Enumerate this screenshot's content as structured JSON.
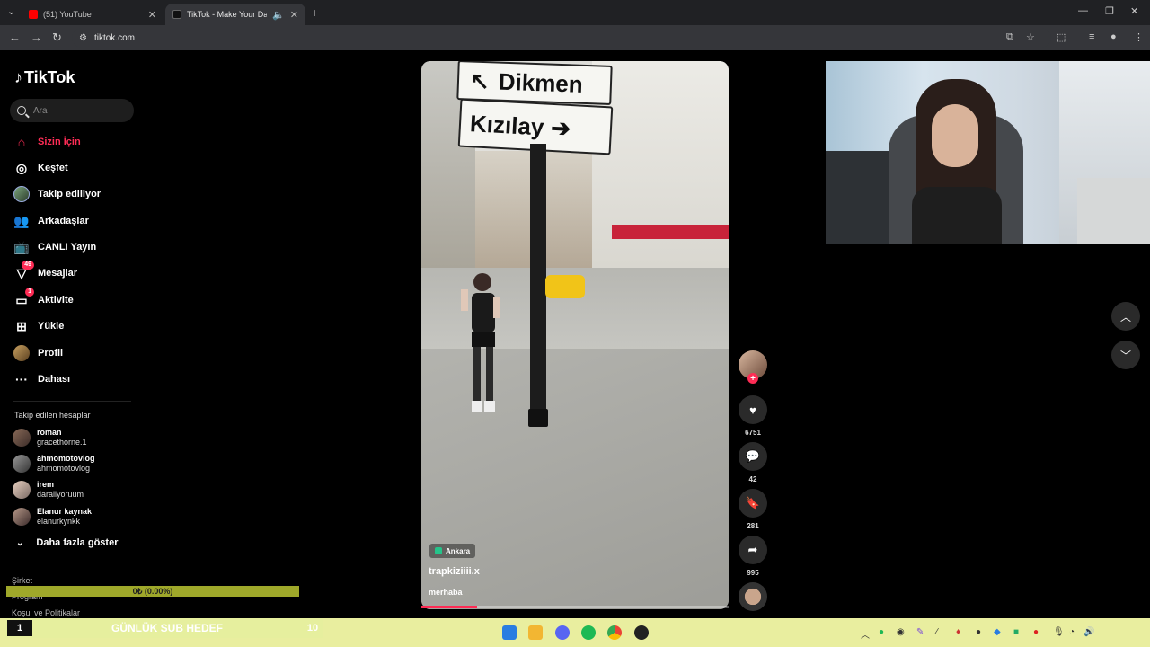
{
  "browser": {
    "tabs": [
      {
        "title": "(51) YouTube",
        "favicon": "youtube-icon",
        "active": false
      },
      {
        "title": "TikTok - Make Your Day",
        "favicon": "tiktok-icon",
        "active": true
      }
    ],
    "url": "tiktok.com"
  },
  "sidebar": {
    "logo": "TikTok",
    "search_placeholder": "Ara",
    "nav": [
      {
        "label": "Sizin İçin",
        "icon": "home-icon",
        "active": true
      },
      {
        "label": "Keşfet",
        "icon": "compass-icon"
      },
      {
        "label": "Takip ediliyor",
        "icon": "following-avatar-icon"
      },
      {
        "label": "Arkadaşlar",
        "icon": "friends-icon"
      },
      {
        "label": "CANLI Yayın",
        "icon": "live-icon"
      },
      {
        "label": "Mesajlar",
        "icon": "messages-icon",
        "badge": "49"
      },
      {
        "label": "Aktivite",
        "icon": "activity-icon",
        "badge": "1"
      },
      {
        "label": "Yükle",
        "icon": "upload-icon"
      },
      {
        "label": "Profil",
        "icon": "profile-avatar-icon"
      },
      {
        "label": "Dahası",
        "icon": "more-icon"
      }
    ],
    "following_title": "Takip edilen hesaplar",
    "following": [
      {
        "name": "roman",
        "handle": "gracethorne.1"
      },
      {
        "name": "ahmomotovlog",
        "handle": "ahmomotovlog"
      },
      {
        "name": "irem",
        "handle": "daraliyoruum"
      },
      {
        "name": "Elanur kaynak",
        "handle": "elanurkynkk"
      }
    ],
    "show_more": "Daha fazla göster",
    "footer": [
      "Şirket",
      "Program",
      "Koşul ve Politikalar"
    ]
  },
  "overlay": {
    "goal_bar_text": "0₺ (0.00%)",
    "goal_progress": 0.0,
    "sub_goal_left": "1",
    "sub_goal_label": "GÜNLÜK SUB HEDEF",
    "sub_goal_right": "10"
  },
  "video": {
    "location": "Ankara",
    "author": "trapkiziiii.x",
    "caption": "merhaba",
    "sign_top": "Dikmen",
    "sign_bottom": "Kızılay",
    "progress": 0.18
  },
  "actions": {
    "likes": "6751",
    "comments": "42",
    "saves": "281",
    "shares": "995"
  },
  "colors": {
    "accent": "#fe2c55",
    "background": "#000000",
    "taskbar": "#e9ee9f"
  }
}
